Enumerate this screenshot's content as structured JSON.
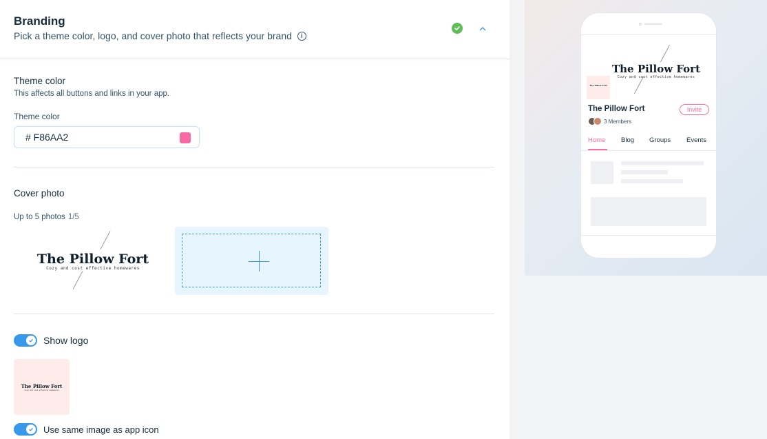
{
  "header": {
    "title": "Branding",
    "subtitle": "Pick a theme color, logo, and cover photo that reflects your brand",
    "status_icon": "check-circle-icon",
    "collapse_icon": "chevron-up-icon"
  },
  "theme": {
    "title": "Theme color",
    "description": "This affects all buttons and links in your app.",
    "field_label": "Theme color",
    "value": "# F86AA2",
    "color": "#F86AA2"
  },
  "cover": {
    "title": "Cover photo",
    "limit_label": "Up to 5 photos",
    "count": "1/5",
    "add_icon": "plus-icon"
  },
  "logo_art": {
    "title": "The Pillow Fort",
    "tagline": "Cozy and cost effective homewares"
  },
  "show_logo": {
    "label": "Show logo",
    "enabled": true
  },
  "app_icon": {
    "label": "Use same image as app icon",
    "enabled": true
  },
  "preview": {
    "name": "The Pillow Fort",
    "invite_label": "Invite",
    "members": "3 Members",
    "tabs": [
      "Home",
      "Blog",
      "Groups",
      "Events"
    ],
    "active_tab": "Home",
    "accent": "#F86AA2"
  },
  "colors": {
    "accent_blue": "#3899EC",
    "success_green": "#60BC57",
    "logo_bg": "#FDECEA"
  }
}
